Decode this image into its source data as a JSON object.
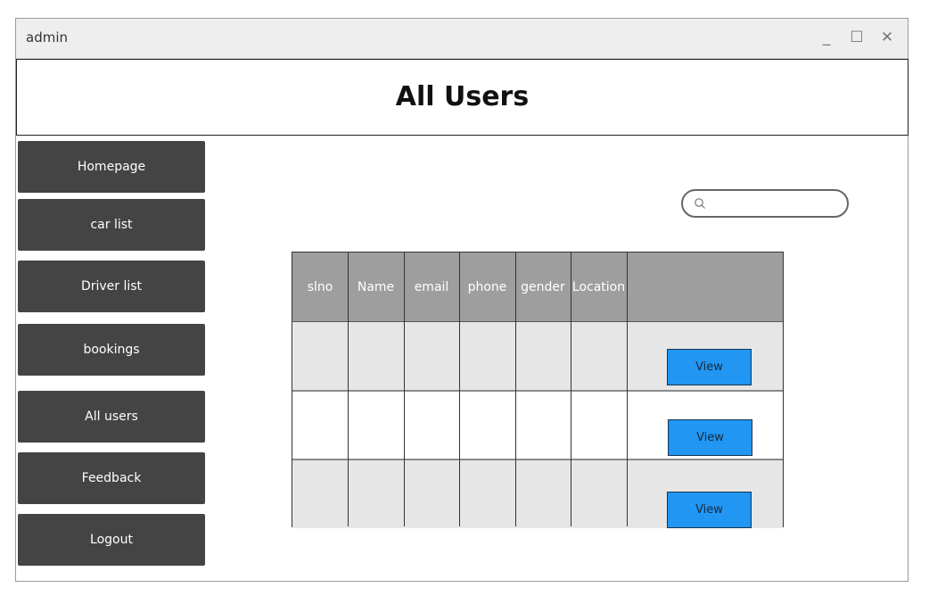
{
  "window": {
    "title": "admin",
    "controls": {
      "minimize": "_",
      "maximize": "☐",
      "close": "✕"
    }
  },
  "header": {
    "title": "All Users"
  },
  "sidebar": {
    "items": [
      {
        "label": "Homepage"
      },
      {
        "label": "car list"
      },
      {
        "label": "Driver list"
      },
      {
        "label": "bookings"
      },
      {
        "label": "All users"
      },
      {
        "label": "Feedback"
      },
      {
        "label": "Logout"
      }
    ]
  },
  "search": {
    "icon": "search-icon",
    "value": "",
    "placeholder": ""
  },
  "table": {
    "columns": [
      "slno",
      "Name",
      "email",
      "phone",
      "gender",
      "Location",
      ""
    ],
    "rows": [
      {
        "cells": [
          "",
          "",
          "",
          "",
          "",
          ""
        ],
        "action": "View"
      },
      {
        "cells": [
          "",
          "",
          "",
          "",
          "",
          ""
        ],
        "action": "View"
      },
      {
        "cells": [
          "",
          "",
          "",
          "",
          "",
          ""
        ],
        "action": "View"
      }
    ]
  },
  "colors": {
    "sidebar_button": "#444444",
    "table_header": "#9e9e9e",
    "row_shaded": "#e6e6e6",
    "view_button": "#2196f3"
  }
}
